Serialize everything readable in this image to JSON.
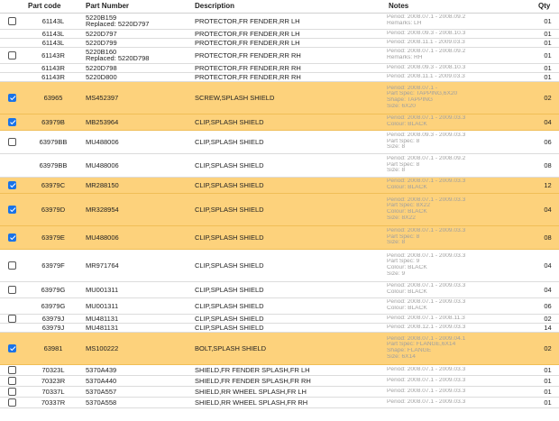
{
  "headers": [
    "",
    "Part code",
    "Part Number",
    "Description",
    "Notes",
    "Qty"
  ],
  "rows": [
    {
      "checkbox": true,
      "checked": false,
      "code": "61143L",
      "pn": [
        "5220B159",
        "Replaced: 5220D797"
      ],
      "desc": "PROTECTOR,FR FENDER,RR LH",
      "notes": [
        "Period: 2008.07.1 - 2008.09.2",
        "Remarks: LH"
      ],
      "qty": "01",
      "h": 18
    },
    {
      "checkbox": false,
      "checked": false,
      "code": "61143L",
      "pn": [
        "5220D797"
      ],
      "desc": "PROTECTOR,FR FENDER,RR LH",
      "notes": [
        "Period: 2008.09.3 - 2008.10.3"
      ],
      "qty": "01",
      "h": 10
    },
    {
      "checkbox": false,
      "checked": false,
      "code": "61143L",
      "pn": [
        "5220D799"
      ],
      "desc": "PROTECTOR,FR FENDER,RR LH",
      "notes": [
        "Period: 2008.11.1 - 2009.03.3"
      ],
      "qty": "01",
      "h": 10
    },
    {
      "checkbox": true,
      "checked": false,
      "code": "61143R",
      "pn": [
        "5220B160",
        "Replaced: 5220D798"
      ],
      "desc": "PROTECTOR,FR FENDER,RR RH",
      "notes": [
        "Period: 2008.07.1 - 2008.09.2",
        "Remarks: RH"
      ],
      "qty": "01",
      "h": 18
    },
    {
      "checkbox": false,
      "checked": false,
      "code": "61143R",
      "pn": [
        "5220D798"
      ],
      "desc": "PROTECTOR,FR FENDER,RR RH",
      "notes": [
        "Period: 2008.09.3 - 2008.10.3"
      ],
      "qty": "01",
      "h": 10
    },
    {
      "checkbox": false,
      "checked": false,
      "code": "61143R",
      "pn": [
        "5220D800"
      ],
      "desc": "PROTECTOR,FR FENDER,RR RH",
      "notes": [
        "Period: 2008.11.1 - 2009.03.3"
      ],
      "qty": "01",
      "h": 10
    },
    {
      "checkbox": true,
      "checked": true,
      "code": "63965",
      "pn": [
        "MS452397"
      ],
      "desc": "SCREW,SPLASH SHIELD",
      "notes": [
        "Period: 2008.07.1 -",
        "Part Spec: TAPPING,6X20",
        "Shape: TAPPING",
        "Size: 6X20"
      ],
      "qty": "02",
      "h": 36
    },
    {
      "checkbox": true,
      "checked": true,
      "code": "63979B",
      "pn": [
        "MB253964"
      ],
      "desc": "CLIP,SPLASH SHIELD",
      "notes": [
        "Period: 2008.07.1 - 2009.03.3",
        "Colour: BLACK"
      ],
      "qty": "04",
      "h": 18
    },
    {
      "checkbox": true,
      "checked": false,
      "code": "63979BB",
      "pn": [
        "MU488006"
      ],
      "desc": "CLIP,SPLASH SHIELD",
      "notes": [
        "Period: 2008.09.3 - 2009.03.3",
        "Part Spec: 8",
        "Size: 8"
      ],
      "qty": "06",
      "h": 26
    },
    {
      "checkbox": false,
      "checked": false,
      "code": "63979BB",
      "pn": [
        "MU488006"
      ],
      "desc": "CLIP,SPLASH SHIELD",
      "notes": [
        "Period: 2008.07.1 - 2008.09.2",
        "Part Spec: 8",
        "Size: 8"
      ],
      "qty": "08",
      "h": 26
    },
    {
      "checkbox": true,
      "checked": true,
      "code": "63979C",
      "pn": [
        "MR288150"
      ],
      "desc": "CLIP,SPLASH SHIELD",
      "notes": [
        "Period: 2008.07.1 - 2009.03.3",
        "Colour: BLACK"
      ],
      "qty": "12",
      "h": 18
    },
    {
      "checkbox": true,
      "checked": true,
      "code": "63979D",
      "pn": [
        "MR328954"
      ],
      "desc": "CLIP,SPLASH SHIELD",
      "notes": [
        "Period: 2008.07.1 - 2009.03.3",
        "Part Spec: 8X22",
        "Colour: BLACK",
        "Size: 8X22"
      ],
      "qty": "04",
      "h": 36
    },
    {
      "checkbox": true,
      "checked": true,
      "code": "63979E",
      "pn": [
        "MU488006"
      ],
      "desc": "CLIP,SPLASH SHIELD",
      "notes": [
        "Period: 2008.07.1 - 2009.03.3",
        "Part Spec: 8",
        "Size: 8"
      ],
      "qty": "08",
      "h": 26
    },
    {
      "checkbox": true,
      "checked": false,
      "code": "63979F",
      "pn": [
        "MR971764"
      ],
      "desc": "CLIP,SPLASH SHIELD",
      "notes": [
        "Period: 2008.07.1 - 2009.03.3",
        "Part Spec: 9",
        "Colour: BLACK",
        "Size: 9"
      ],
      "qty": "04",
      "h": 36
    },
    {
      "checkbox": true,
      "checked": false,
      "code": "63979G",
      "pn": [
        "MU001311"
      ],
      "desc": "CLIP,SPLASH SHIELD",
      "notes": [
        "Period: 2008.07.1 - 2009.03.3",
        "Colour: BLACK"
      ],
      "qty": "04",
      "h": 18
    },
    {
      "checkbox": false,
      "checked": false,
      "code": "63979G",
      "pn": [
        "MU001311"
      ],
      "desc": "CLIP,SPLASH SHIELD",
      "notes": [
        "Period: 2008.07.1 - 2009.03.3",
        "Colour: BLACK"
      ],
      "qty": "06",
      "h": 18
    },
    {
      "checkbox": true,
      "checked": false,
      "code": "63979J",
      "pn": [
        "MU481131"
      ],
      "desc": "CLIP,SPLASH SHIELD",
      "notes": [
        "Period: 2008.07.1 - 2008.11.3"
      ],
      "qty": "02",
      "h": 10
    },
    {
      "checkbox": false,
      "checked": false,
      "code": "63979J",
      "pn": [
        "MU481131"
      ],
      "desc": "CLIP,SPLASH SHIELD",
      "notes": [
        "Period: 2008.12.1 - 2009.03.3"
      ],
      "qty": "14",
      "h": 10
    },
    {
      "checkbox": true,
      "checked": true,
      "code": "63981",
      "pn": [
        "MS100222"
      ],
      "desc": "BOLT,SPLASH SHIELD",
      "notes": [
        "Period: 2008.07.1 - 2009.04.1",
        "Part Spec: FLANGE,6X14",
        "Shape: FLANGE",
        "Size: 6X14"
      ],
      "qty": "02",
      "h": 36
    },
    {
      "checkbox": true,
      "checked": false,
      "code": "70323L",
      "pn": [
        "5370A439"
      ],
      "desc": "SHIELD,FR FENDER SPLASH,FR LH",
      "notes": [
        "Period: 2008.07.1 - 2009.03.3"
      ],
      "qty": "01",
      "h": 12
    },
    {
      "checkbox": true,
      "checked": false,
      "code": "70323R",
      "pn": [
        "5370A440"
      ],
      "desc": "SHIELD,FR FENDER SPLASH,FR RH",
      "notes": [
        "Period: 2008.07.1 - 2009.03.3"
      ],
      "qty": "01",
      "h": 12
    },
    {
      "checkbox": true,
      "checked": false,
      "code": "70337L",
      "pn": [
        "5370A557"
      ],
      "desc": "SHIELD,RR WHEEL SPLASH,FR LH",
      "notes": [
        "Period: 2008.07.1 - 2009.03.3"
      ],
      "qty": "01",
      "h": 12
    },
    {
      "checkbox": true,
      "checked": false,
      "code": "70337R",
      "pn": [
        "5370A558"
      ],
      "desc": "SHIELD,RR WHEEL SPLASH,FR RH",
      "notes": [
        "Period: 2008.07.1 - 2009.03.3"
      ],
      "qty": "01",
      "h": 12
    }
  ]
}
